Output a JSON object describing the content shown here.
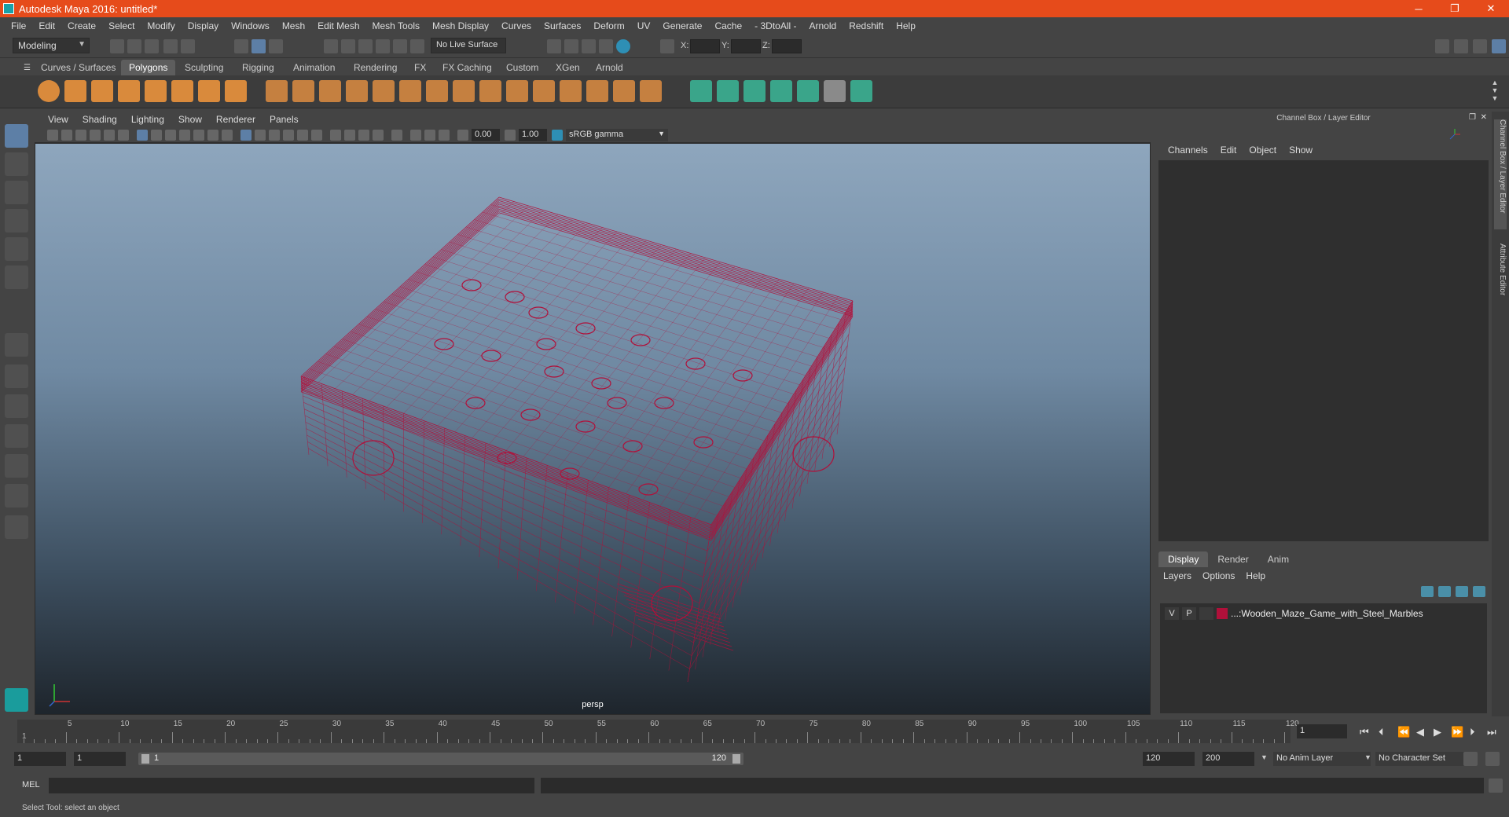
{
  "window": {
    "title": "Autodesk Maya 2016: untitled*",
    "controls": [
      "─",
      "❐",
      "✕"
    ]
  },
  "menubar": [
    "File",
    "Edit",
    "Create",
    "Select",
    "Modify",
    "Display",
    "Windows",
    "Mesh",
    "Edit Mesh",
    "Mesh Tools",
    "Mesh Display",
    "Curves",
    "Surfaces",
    "Deform",
    "UV",
    "Generate",
    "Cache",
    "- 3DtoAll -",
    "Arnold",
    "Redshift",
    "Help"
  ],
  "statusline": {
    "mode": "Modeling",
    "live_surface": "No Live Surface",
    "x_label": "X:",
    "y_label": "Y:",
    "z_label": "Z:"
  },
  "shelf_tabs": [
    "Curves / Surfaces",
    "Polygons",
    "Sculpting",
    "Rigging",
    "Animation",
    "Rendering",
    "FX",
    "FX Caching",
    "Custom",
    "XGen",
    "Arnold"
  ],
  "shelf_active": "Polygons",
  "viewport": {
    "menu": [
      "View",
      "Shading",
      "Lighting",
      "Show",
      "Renderer",
      "Panels"
    ],
    "exposure": "0.00",
    "gamma": "1.00",
    "color_space": "sRGB gamma",
    "camera_label": "persp",
    "wire_color": "#b0103a"
  },
  "channel_box": {
    "title": "Channel Box / Layer Editor",
    "menu": [
      "Channels",
      "Edit",
      "Object",
      "Show"
    ]
  },
  "layer_editor": {
    "tabs": [
      "Display",
      "Render",
      "Anim"
    ],
    "active_tab": "Display",
    "menu": [
      "Layers",
      "Options",
      "Help"
    ],
    "layer": {
      "v": "V",
      "p": "P",
      "name": "...:Wooden_Maze_Game_with_Steel_Marbles",
      "color": "#b0103a"
    }
  },
  "side_tabs": [
    "Channel Box / Layer Editor",
    "Attribute Editor"
  ],
  "timeline": {
    "ticks": [
      "5",
      "10",
      "15",
      "20",
      "25",
      "30",
      "35",
      "40",
      "45",
      "50",
      "55",
      "60",
      "65",
      "70",
      "75",
      "80",
      "85",
      "90",
      "95",
      "100",
      "105",
      "110",
      "115",
      "120"
    ],
    "start_label": "1",
    "current_frame": "1"
  },
  "range": {
    "start": "1",
    "playback_start": "1",
    "slider_start": "1",
    "slider_end": "120",
    "playback_end": "120",
    "end": "200",
    "anim_layer": "No Anim Layer",
    "character_set": "No Character Set"
  },
  "command": {
    "label": "MEL"
  },
  "help_line": "Select Tool: select an object"
}
